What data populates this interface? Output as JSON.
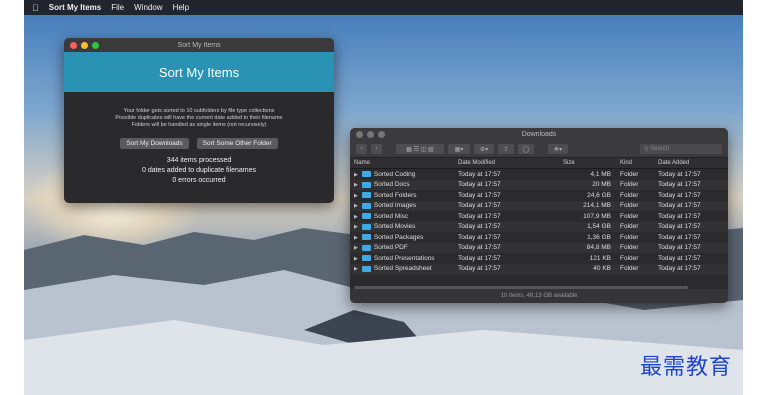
{
  "menubar": {
    "apple": "",
    "app_name": "Sort My Items",
    "items": [
      "File",
      "Window",
      "Help"
    ]
  },
  "sort_window": {
    "title": "Sort My Items",
    "banner": "Sort My Items",
    "description": [
      "Your folder gets sorted to 10 subfolders by file type collections",
      "Possible duplicates will have the current date added to their filename",
      "Folders will be handled as single items (not recursively)"
    ],
    "buttons": [
      "Sort My Downloads",
      "Sort Some Other Folder"
    ],
    "stats": [
      "344 items processed",
      "0 dates added to duplicate filenames",
      "0 errors occurred"
    ]
  },
  "finder": {
    "title": "Downloads",
    "search_placeholder": "Search",
    "columns": [
      "Name",
      "Date Modified",
      "Size",
      "Kind",
      "Date Added"
    ],
    "rows": [
      [
        "Sorted Coding",
        "Today at 17:57",
        "4,1 MB",
        "Folder",
        "Today at 17:57"
      ],
      [
        "Sorted Docs",
        "Today at 17:57",
        "20 MB",
        "Folder",
        "Today at 17:57"
      ],
      [
        "Sorted Folders",
        "Today at 17:57",
        "24,6 GB",
        "Folder",
        "Today at 17:57"
      ],
      [
        "Sorted Images",
        "Today at 17:57",
        "214,1 MB",
        "Folder",
        "Today at 17:57"
      ],
      [
        "Sorted Misc",
        "Today at 17:57",
        "107,9 MB",
        "Folder",
        "Today at 17:57"
      ],
      [
        "Sorted Movies",
        "Today at 17:57",
        "1,54 GB",
        "Folder",
        "Today at 17:57"
      ],
      [
        "Sorted Packages",
        "Today at 17:57",
        "1,36 GB",
        "Folder",
        "Today at 17:57"
      ],
      [
        "Sorted PDF",
        "Today at 17:57",
        "84,8 MB",
        "Folder",
        "Today at 17:57"
      ],
      [
        "Sorted Presentations",
        "Today at 17:57",
        "121 KB",
        "Folder",
        "Today at 17:57"
      ],
      [
        "Sorted Spreadsheet",
        "Today at 17:57",
        "40 KB",
        "Folder",
        "Today at 17:57"
      ]
    ],
    "status": "10 items, 48,13 GB available"
  },
  "watermark": "最需教育"
}
